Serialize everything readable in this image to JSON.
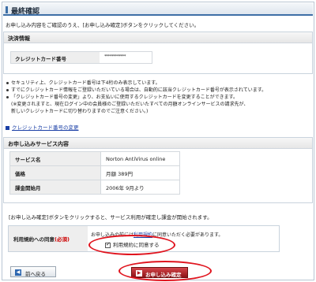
{
  "header": {
    "title": "最終確認"
  },
  "intro": "お申し込み内容をご確認のうえ、[お申し込み確定]ボタンをクリックしてください。",
  "payment": {
    "section_title": "決済情報",
    "card_label": "クレジットカード番号",
    "card_value": "************"
  },
  "notes": [
    "セキュリティ上、クレジットカード番号は下4桁のみ表示しています。",
    "すでにクレジットカード情報をご登録いただいている場合は、自動的に該当クレジットカード番号が表示されています。",
    "「クレジットカード番号の変更」より、お支払いに使用するクレジットカードを変更することができます。"
  ],
  "notes_sub": [
    "(※変更されますと、現在ログイン中の会員様のご登録いただいたすべての月額オンラインサービスの請求先が、",
    "新しいクレジットカードに切り替わりますのでご注意ください。)"
  ],
  "change_link": "クレジットカード番号の変更",
  "service": {
    "section_title": "お申し込みサービス内容",
    "rows": [
      {
        "key": "サービス名",
        "value": "Norton AntiVirus online"
      },
      {
        "key": "価格",
        "value": "月額 389円"
      },
      {
        "key": "課金開始月",
        "value": "2006年 9月より"
      }
    ]
  },
  "confirm_note": "[お申し込み確定]ボタンをクリックすると、サービス利用が確定し課金が開始されます。",
  "agreement": {
    "label": "利用規約への同意",
    "required": "(必須)",
    "message_pre": "お申し込みの前には",
    "message_link": "利用規約",
    "message_post": "に同意いただく必要があります。",
    "checkbox_label": "利用規約に同意する",
    "checked": true
  },
  "buttons": {
    "back": "前へ戻る",
    "apply": "お申し込み確定"
  },
  "colors": {
    "accent": "#3d6fa6",
    "highlight": "#e0141e",
    "apply_button": "#b11a1f",
    "link": "#1a3fa6"
  }
}
